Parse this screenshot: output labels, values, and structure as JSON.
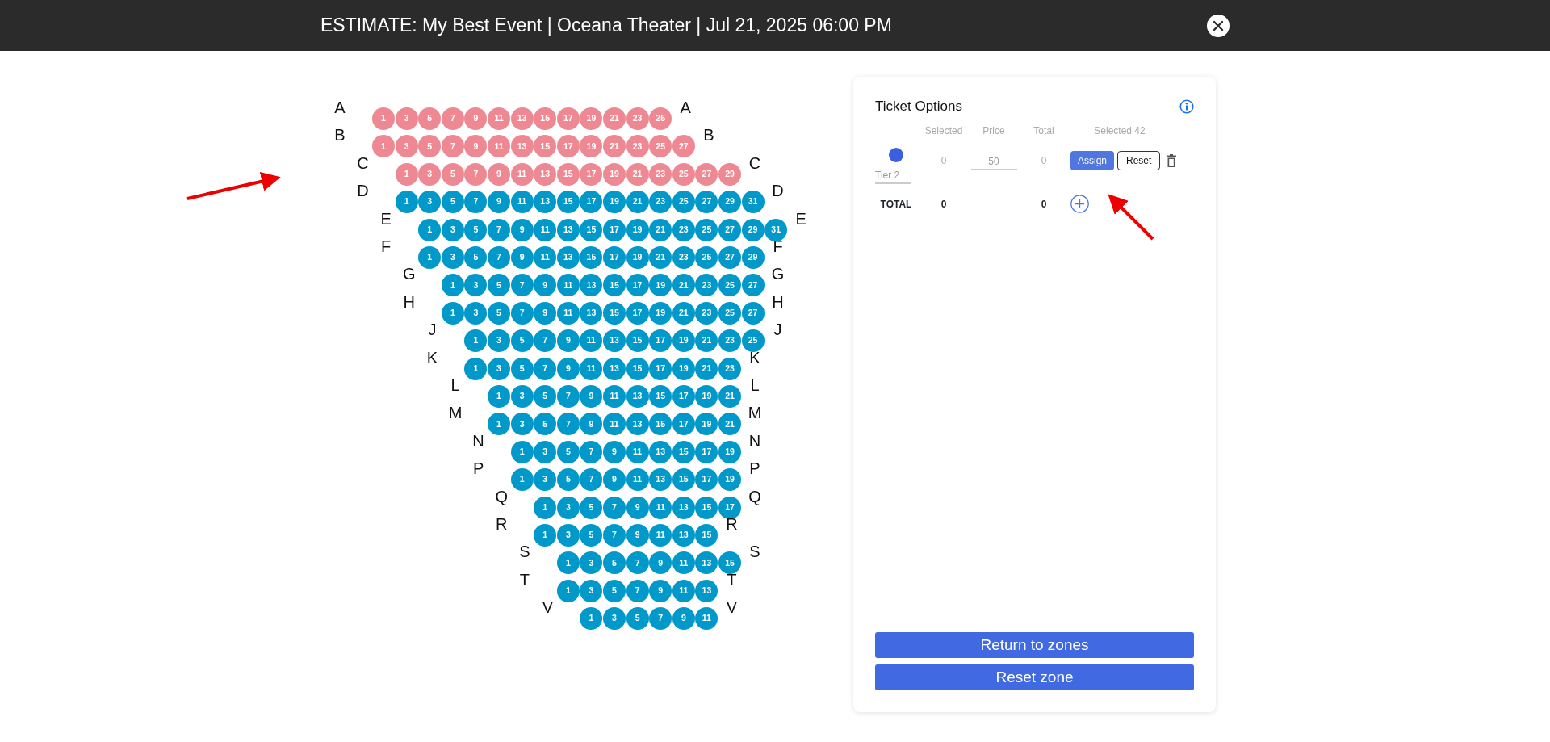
{
  "header": {
    "title": "ESTIMATE: My Best Event | Oceana Theater | Jul 21, 2025 06:00 PM"
  },
  "seat_map": {
    "rows": [
      {
        "left_label": "A",
        "right_label": "A",
        "selected": true,
        "seats": [
          "1",
          "3",
          "5",
          "7",
          "9",
          "11",
          "13",
          "15",
          "17",
          "19",
          "21",
          "23",
          "25"
        ]
      },
      {
        "left_label": "B",
        "right_label": "B",
        "selected": true,
        "seats": [
          "1",
          "3",
          "5",
          "7",
          "9",
          "11",
          "13",
          "15",
          "17",
          "19",
          "21",
          "23",
          "25",
          "27"
        ]
      },
      {
        "left_label": "C",
        "right_label": "C",
        "selected": true,
        "seats": [
          "1",
          "3",
          "5",
          "7",
          "9",
          "11",
          "13",
          "15",
          "17",
          "19",
          "21",
          "23",
          "25",
          "27",
          "29"
        ]
      },
      {
        "left_label": "D",
        "right_label": "D",
        "selected": false,
        "seats": [
          "1",
          "3",
          "5",
          "7",
          "9",
          "11",
          "13",
          "15",
          "17",
          "19",
          "21",
          "23",
          "25",
          "27",
          "29",
          "31"
        ]
      },
      {
        "left_label": "E",
        "right_label": "E",
        "selected": false,
        "seats": [
          "1",
          "3",
          "5",
          "7",
          "9",
          "11",
          "13",
          "15",
          "17",
          "19",
          "21",
          "23",
          "25",
          "27",
          "29",
          "31"
        ]
      },
      {
        "left_label": "F",
        "right_label": "F",
        "selected": false,
        "seats": [
          "1",
          "3",
          "5",
          "7",
          "9",
          "11",
          "13",
          "15",
          "17",
          "19",
          "21",
          "23",
          "25",
          "27",
          "29"
        ]
      },
      {
        "left_label": "G",
        "right_label": "G",
        "selected": false,
        "seats": [
          "1",
          "3",
          "5",
          "7",
          "9",
          "11",
          "13",
          "15",
          "17",
          "19",
          "21",
          "23",
          "25",
          "27"
        ]
      },
      {
        "left_label": "H",
        "right_label": "H",
        "selected": false,
        "seats": [
          "1",
          "3",
          "5",
          "7",
          "9",
          "11",
          "13",
          "15",
          "17",
          "19",
          "21",
          "23",
          "25",
          "27"
        ]
      },
      {
        "left_label": "J",
        "right_label": "J",
        "selected": false,
        "seats": [
          "1",
          "3",
          "5",
          "7",
          "9",
          "11",
          "13",
          "15",
          "17",
          "19",
          "21",
          "23",
          "25"
        ]
      },
      {
        "left_label": "K",
        "right_label": "K",
        "selected": false,
        "seats": [
          "1",
          "3",
          "5",
          "7",
          "9",
          "11",
          "13",
          "15",
          "17",
          "19",
          "21",
          "23"
        ]
      },
      {
        "left_label": "L",
        "right_label": "L",
        "selected": false,
        "seats": [
          "1",
          "3",
          "5",
          "7",
          "9",
          "11",
          "13",
          "15",
          "17",
          "19",
          "21"
        ]
      },
      {
        "left_label": "M",
        "right_label": "M",
        "selected": false,
        "seats": [
          "1",
          "3",
          "5",
          "7",
          "9",
          "11",
          "13",
          "15",
          "17",
          "19",
          "21"
        ]
      },
      {
        "left_label": "N",
        "right_label": "N",
        "selected": false,
        "seats": [
          "1",
          "3",
          "5",
          "7",
          "9",
          "11",
          "13",
          "15",
          "17",
          "19"
        ]
      },
      {
        "left_label": "P",
        "right_label": "P",
        "selected": false,
        "seats": [
          "1",
          "3",
          "5",
          "7",
          "9",
          "11",
          "13",
          "15",
          "17",
          "19"
        ]
      },
      {
        "left_label": "Q",
        "right_label": "Q",
        "selected": false,
        "seats": [
          "1",
          "3",
          "5",
          "7",
          "9",
          "11",
          "13",
          "15",
          "17"
        ]
      },
      {
        "left_label": "R",
        "right_label": "R",
        "selected": false,
        "seats": [
          "1",
          "3",
          "5",
          "7",
          "9",
          "11",
          "13",
          "15"
        ]
      },
      {
        "left_label": "S",
        "right_label": "S",
        "selected": false,
        "seats": [
          "1",
          "3",
          "5",
          "7",
          "9",
          "11",
          "13",
          "15"
        ]
      },
      {
        "left_label": "T",
        "right_label": "T",
        "selected": false,
        "seats": [
          "1",
          "3",
          "5",
          "7",
          "9",
          "11",
          "13"
        ]
      },
      {
        "left_label": "V",
        "right_label": "V",
        "selected": false,
        "seats": [
          "1",
          "3",
          "5",
          "7",
          "9",
          "11"
        ]
      }
    ]
  },
  "ticket_options": {
    "title": "Ticket Options",
    "columns": [
      "Selected",
      "Price",
      "Total",
      "Selected 42"
    ],
    "tiers": [
      {
        "name": "Tier 2",
        "color": "#3b5fe0",
        "selected": "0",
        "price": "50",
        "total": "0",
        "assign_button": "Assign",
        "reset_button": "Reset"
      }
    ],
    "total": {
      "label": "TOTAL",
      "selected": "0",
      "total": "0"
    }
  },
  "buttons": [
    "Return to zones",
    "Reset zone"
  ]
}
